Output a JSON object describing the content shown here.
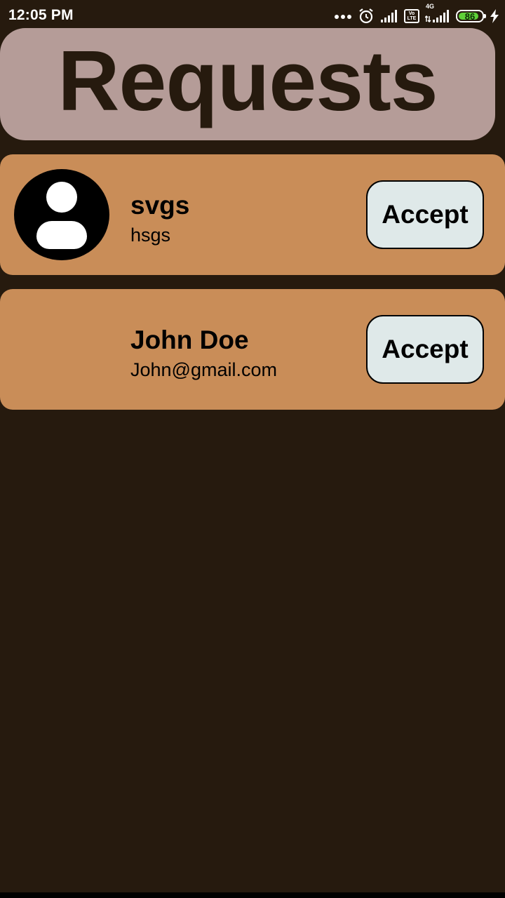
{
  "status_bar": {
    "time": "12:05 PM",
    "lte_label": "Vo LTE",
    "network_label": "4G",
    "battery_level": 86,
    "battery_text": "86",
    "battery_color": "#5fd138"
  },
  "header": {
    "title": "Requests"
  },
  "requests": [
    {
      "name": "svgs",
      "subtitle": "hsgs",
      "has_avatar": true,
      "button_label": "Accept"
    },
    {
      "name": "John Doe",
      "subtitle": "John@gmail.com",
      "has_avatar": false,
      "button_label": "Accept"
    }
  ],
  "colors": {
    "background": "#261a0e",
    "header_bg": "#b59c98",
    "card_bg": "#c98d58",
    "button_bg": "#dfe9e9"
  },
  "icons": {
    "status": [
      "more-dots-icon",
      "alarm-icon",
      "signal-icon",
      "volte-icon",
      "signal-4g-icon",
      "battery-icon",
      "charging-bolt-icon"
    ],
    "avatar": "default-user-icon"
  }
}
